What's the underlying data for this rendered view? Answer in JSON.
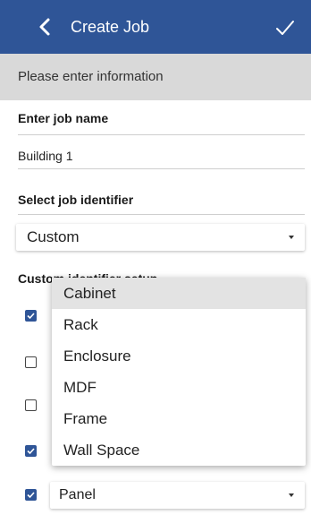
{
  "appbar": {
    "title": "Create Job",
    "back_icon": "chevron-left-icon",
    "confirm_icon": "checkmark-icon",
    "color": "#2f5597"
  },
  "subheader": {
    "text": "Please enter information"
  },
  "job_name": {
    "label": "Enter job name",
    "value": "Building 1"
  },
  "job_identifier": {
    "label": "Select job identifier",
    "selected": "Custom"
  },
  "custom_setup": {
    "label": "Custom identifier setup"
  },
  "rows": [
    {
      "checked": true
    },
    {
      "checked": false
    },
    {
      "checked": false
    },
    {
      "checked": true
    },
    {
      "checked": true,
      "value": "Panel"
    }
  ],
  "dropdown": {
    "options": [
      "Cabinet",
      "Rack",
      "Enclosure",
      "MDF",
      "Frame",
      "Wall Space"
    ],
    "highlighted": "Cabinet"
  }
}
